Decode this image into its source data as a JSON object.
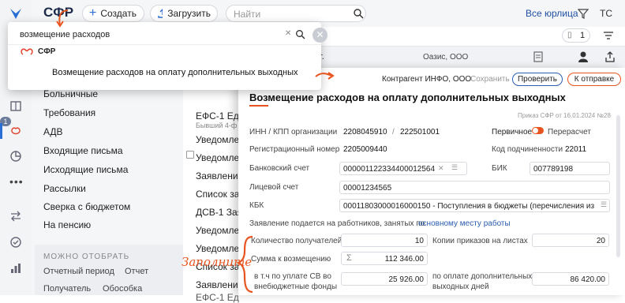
{
  "app": {
    "logo": "СФР"
  },
  "toolbar": {
    "create_label": "Создать",
    "upload_label": "Загрузить",
    "search_placeholder": "Найти",
    "org_select": "Все юрлица",
    "user_initials": "ТС",
    "counter": "1"
  },
  "rail": {
    "badge": "1"
  },
  "popup": {
    "query": "возмещение расходов",
    "suggestion_logo_text": "СФР",
    "suggestion_result": "Возмещение расходов на оплату дополнительных выходных"
  },
  "nav": {
    "items": [
      "Больничные",
      "Требования",
      "АДВ",
      "Входящие письма",
      "Исходящие письма",
      "Рассылки",
      "Сверка с бюджетом",
      "На пенсию"
    ],
    "filter_title": "МОЖНО ОТОБРАТЬ",
    "filter_links": [
      "Отчетный период",
      "Отчет",
      "Получатель",
      "Обособка"
    ]
  },
  "list": {
    "items": [
      "ЕФС-1 Ед",
      "Бывший 4-ф",
      "Уведомле",
      "Уведомле",
      "Заявлени",
      "Список за",
      "ДСВ-1 Зая",
      "Уведомле",
      "Уведомле",
      "Список за",
      "Заявлени",
      "ЕФС-1 Ед"
    ],
    "row_snippet": "ат.",
    "row_org": "Оазис, ООО"
  },
  "form": {
    "counterparty": "Контрагент ИНФО, ООО",
    "save_label": "Сохранить",
    "check_label": "Проверить",
    "send_label": "К отправке",
    "title": "Возмещение расходов на оплату дополнительных выходных",
    "order_ref": "Приказ СФР от 16.01.2024 №28",
    "inn_label": "ИНН / КПП организации",
    "inn_value": "2208045910",
    "kpp_value": "222501001",
    "primary_label": "Первичное",
    "recalc_label": "Перерасчет",
    "regnum_label": "Регистрационный номер",
    "regnum_value": "2205009440",
    "subord_label": "Код подчиненности",
    "subord_value": "22011",
    "bank_label": "Банковский счет",
    "bank_value": "000001122334400012564",
    "bik_label": "БИК",
    "bik_value": "007789198",
    "personal_label": "Лицевой счет",
    "personal_value": "00001234565",
    "kbk_label": "КБК",
    "kbk_value": "00011803000016000150 - Поступления в бюджеты (перечисления из ...",
    "statement_text": "Заявление подается на работников, занятых по",
    "statement_link": "основному месту работы",
    "recipients_label": "Количество получателей",
    "recipients_value": "10",
    "copies_label": "Копии приказов на листах",
    "copies_value": "20",
    "sum_label": "Сумма к возмещению",
    "sum_value": "112 346.00",
    "sv_label_1": "в т.ч по уплате СВ во",
    "sv_label_2": "внебюджетные фонды",
    "sv_value": "25 926.00",
    "extra_label_1": "по оплате дополнительных",
    "extra_label_2": "выходных дней",
    "extra_value": "86 420.00"
  },
  "annotation": {
    "fill_label": "Заполните"
  },
  "colors": {
    "accent": "#e8541f",
    "link": "#2a5db0",
    "brand_blue": "#1e4fa3"
  }
}
